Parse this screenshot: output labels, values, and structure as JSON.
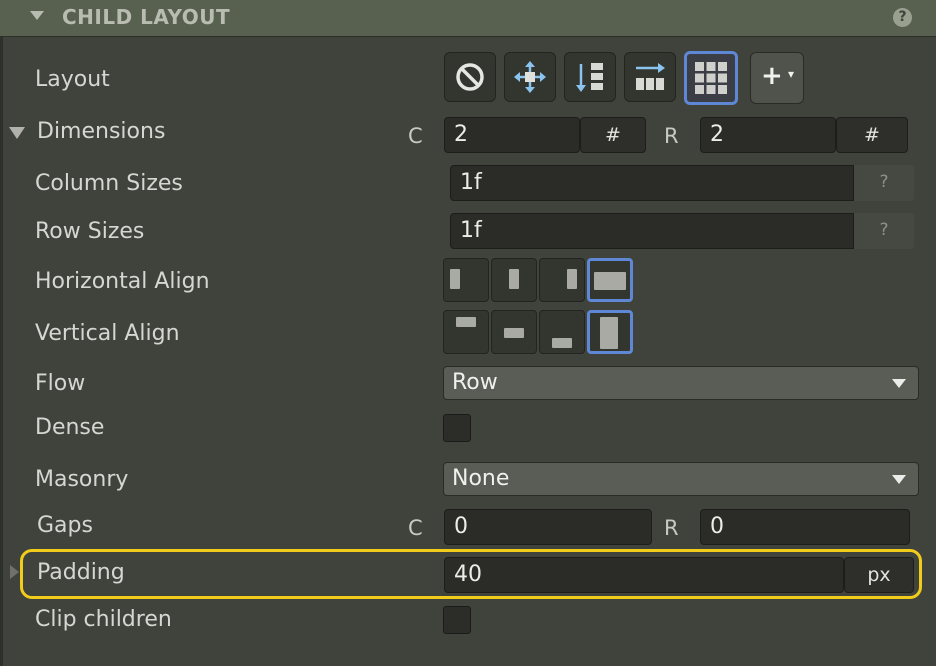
{
  "header": {
    "title": "CHILD LAYOUT",
    "help_glyph": "?"
  },
  "layout": {
    "label": "Layout",
    "options": [
      "none-icon",
      "move-icon",
      "column-stack-icon",
      "row-flow-icon",
      "grid-icon"
    ],
    "selected": "grid-icon",
    "add_glyph": "+"
  },
  "dimensions": {
    "label": "Dimensions",
    "col_label": "C",
    "col_value": "2",
    "col_unit": "#",
    "row_label": "R",
    "row_value": "2",
    "row_unit": "#"
  },
  "column_sizes": {
    "label": "Column Sizes",
    "value": "1f",
    "help": "?"
  },
  "row_sizes": {
    "label": "Row Sizes",
    "value": "1f",
    "help": "?"
  },
  "horizontal_align": {
    "label": "Horizontal Align",
    "options": [
      "start",
      "center",
      "end",
      "stretch"
    ],
    "selected": "stretch"
  },
  "vertical_align": {
    "label": "Vertical Align",
    "options": [
      "start",
      "center",
      "end",
      "stretch"
    ],
    "selected": "stretch"
  },
  "flow": {
    "label": "Flow",
    "value": "Row"
  },
  "dense": {
    "label": "Dense",
    "checked": false
  },
  "masonry": {
    "label": "Masonry",
    "value": "None"
  },
  "gaps": {
    "label": "Gaps",
    "col_label": "C",
    "col_value": "0",
    "row_label": "R",
    "row_value": "0"
  },
  "padding": {
    "label": "Padding",
    "value": "40",
    "unit": "px"
  },
  "clip_children": {
    "label": "Clip children",
    "checked": false
  },
  "colors": {
    "accent": "#5e88d6",
    "highlight": "#f2cc1a",
    "header": "#586050",
    "panel": "#40423c"
  }
}
